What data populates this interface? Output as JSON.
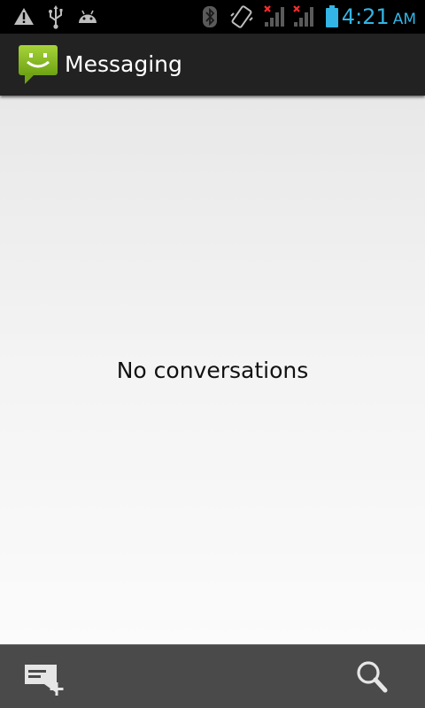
{
  "status_bar": {
    "icons": [
      "warning-icon",
      "usb-icon",
      "android-debug-icon",
      "bluetooth-icon",
      "vibrate-icon",
      "signal-no-service-icon",
      "signal-no-service-icon",
      "battery-icon"
    ],
    "time": "4:21",
    "ampm": "AM",
    "clock_color": "#33b5e5"
  },
  "action_bar": {
    "title": "Messaging",
    "icon": "messaging-app-icon",
    "icon_color": "#8dc21f"
  },
  "main": {
    "empty_message": "No conversations"
  },
  "bottom_bar": {
    "buttons": [
      {
        "name": "compose-new-message",
        "icon": "compose-icon"
      },
      {
        "name": "search",
        "icon": "search-icon"
      }
    ]
  }
}
